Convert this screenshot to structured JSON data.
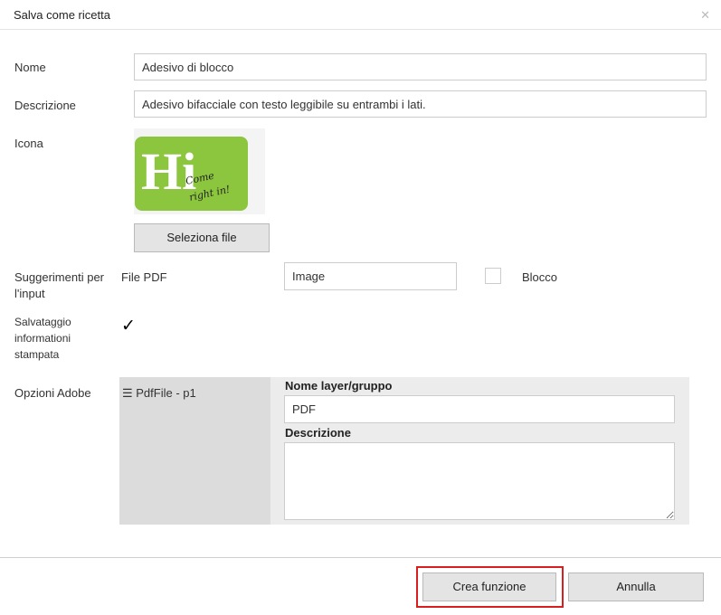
{
  "dialog": {
    "title": "Salva come ricetta"
  },
  "form": {
    "name_label": "Nome",
    "name_value": "Adesivo di blocco",
    "description_label": "Descrizione",
    "description_value": "Adesivo bifacciale con testo leggibile su entrambi i lati.",
    "icon_label": "Icona",
    "icon_big_text": "Hi",
    "icon_script_line1": "Come",
    "icon_script_line2": "right in!",
    "select_file_label": "Seleziona file",
    "input_hints_label": "Suggerimenti per l'input",
    "pdf_file_label": "File PDF",
    "image_value": "Image",
    "block_label": "Blocco",
    "save_print_info_label": "Salvataggio informationi stampata",
    "save_print_info_checked": "✓",
    "adobe_options_label": "Opzioni Adobe",
    "layer_item": "☰ PdfFile - p1",
    "layer_name_label": "Nome layer/gruppo",
    "layer_name_value": "PDF",
    "layer_description_label": "Descrizione",
    "layer_description_value": ""
  },
  "footer": {
    "create_label": "Crea funzione",
    "cancel_label": "Annulla"
  },
  "colors": {
    "highlight": "#d81e1e",
    "icon_green": "#8cc63f"
  }
}
